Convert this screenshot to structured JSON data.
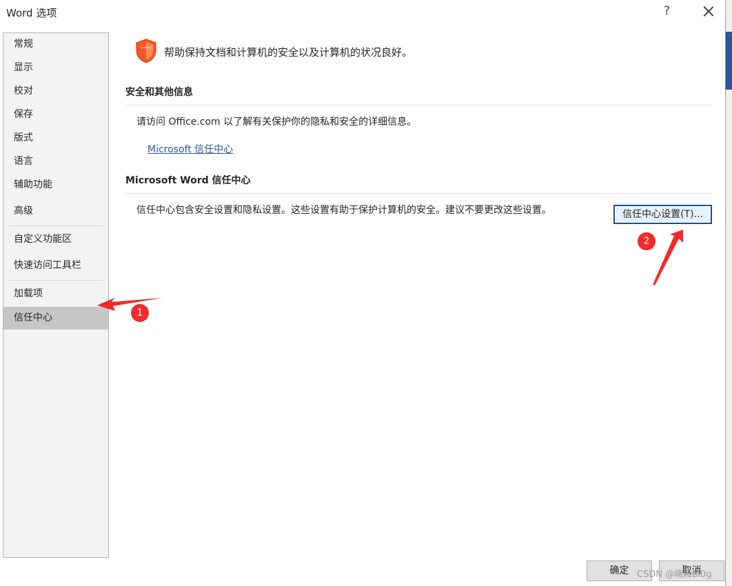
{
  "window": {
    "title": "Word 选项",
    "help_label": "?"
  },
  "sidebar": {
    "items": [
      {
        "label": "常规"
      },
      {
        "label": "显示"
      },
      {
        "label": "校对"
      },
      {
        "label": "保存"
      },
      {
        "label": "版式"
      },
      {
        "label": "语言"
      },
      {
        "label": "辅助功能"
      },
      {
        "label": "高级"
      },
      {
        "label": "自定义功能区"
      },
      {
        "label": "快速访问工具栏"
      },
      {
        "label": "加载项"
      },
      {
        "label": "信任中心"
      }
    ],
    "selected": "信任中心"
  },
  "main": {
    "headline": "帮助保持文档和计算机的安全以及计算机的状况良好。",
    "security_section": {
      "title": "安全和其他信息",
      "description": "请访问 Office.com 以了解有关保护你的隐私和安全的详细信息。",
      "link": "Microsoft 信任中心"
    },
    "trust_section": {
      "title": "Microsoft Word 信任中心",
      "description": "信任中心包含安全设置和隐私设置。这些设置有助于保护计算机的安全。建议不要更改这些设置。",
      "button": "信任中心设置(T)..."
    }
  },
  "footer": {
    "ok": "确定",
    "cancel": "取消"
  },
  "annotations": {
    "badge_1": "1",
    "badge_2": "2"
  },
  "watermark": "CSDN @晓梅bl0g",
  "colors": {
    "accent": "#2b579a",
    "shield": "#f2592a",
    "annotation": "#f22a2a"
  }
}
